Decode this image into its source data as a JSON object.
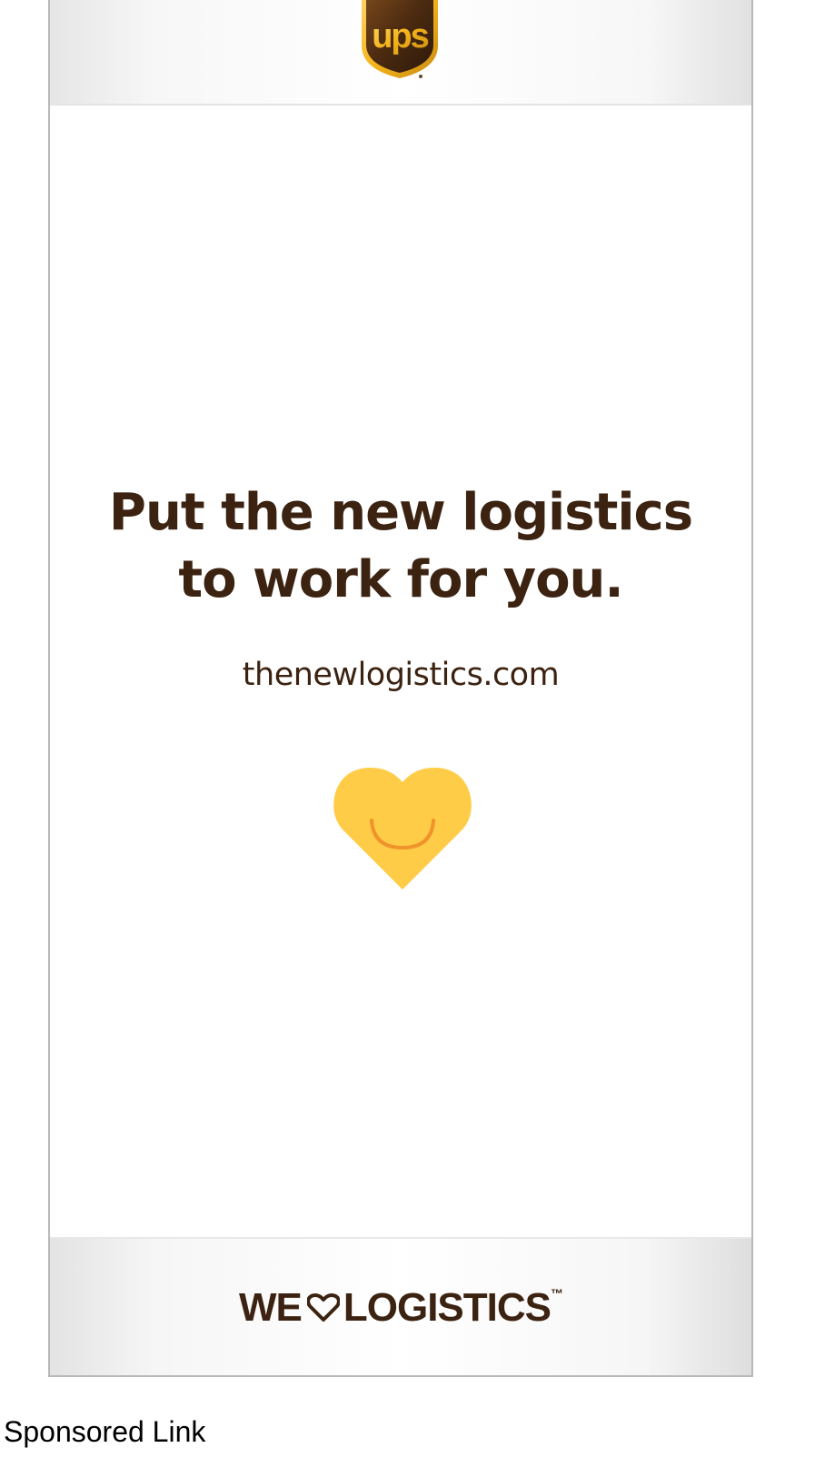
{
  "ad": {
    "brand_logo_text": "ups",
    "headline_line1": "Put the new logistics",
    "headline_line2": "to work for you.",
    "url": "thenewlogistics.com",
    "tagline_left": "WE",
    "tagline_right": "LOGISTICS",
    "tagline_tm": "™",
    "heart_icon": "smiling-heart-icon",
    "colors": {
      "brown": "#3c2311",
      "shield_gold": "#f4b51b",
      "heart_yellow": "#ffcc47",
      "smile_orange": "#f0932b",
      "frame_border": "#b9b9b9"
    }
  },
  "caption": "Sponsored Link"
}
